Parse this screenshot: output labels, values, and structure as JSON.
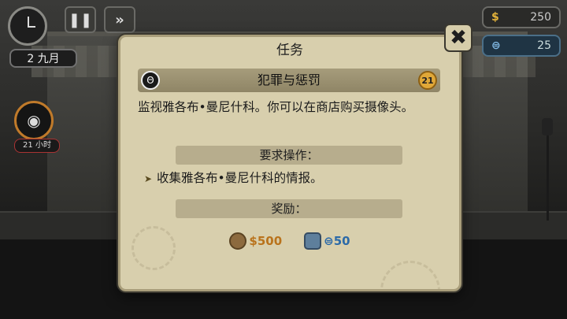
{
  "hud": {
    "date": "2 九月",
    "pause_symbol": "❚❚",
    "fast_forward_symbol": "»",
    "money": "250",
    "money_icon": "$",
    "credits": "25",
    "credits_icon": "⊜",
    "side_badge_time": "21 小时"
  },
  "dialog": {
    "title": "任务",
    "mission_name": "犯罪与惩罚",
    "mission_level": "21",
    "description": "监视雅各布•曼尼什科。你可以在商店购买摄像头。",
    "requirements_header": "要求操作：",
    "requirement_item": "收集雅各布•曼尼什科的情报。",
    "rewards_header": "奖励：",
    "reward_money": "$500",
    "reward_credits": "⊜50",
    "close_symbol": "✖"
  },
  "colors": {
    "panel_bg": "#d8cfad",
    "money_accent": "#b9731c",
    "credits_accent": "#2c6aa8",
    "level_badge": "#e0a838"
  }
}
